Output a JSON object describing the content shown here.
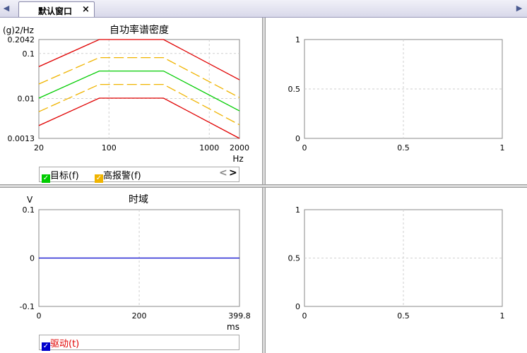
{
  "tabbar": {
    "left_arrow": "◀",
    "right_arrow": "▶",
    "active_tab": "默认窗口",
    "close": "×"
  },
  "psd": {
    "title": "自功率谱密度",
    "ylabel": "(g)2/Hz",
    "xlabel": "Hz",
    "y_ticks": [
      "0.2042",
      "0.1",
      "0.01",
      "0.0013"
    ],
    "x_ticks": [
      "20",
      "100",
      "1000",
      "2000"
    ],
    "legend": {
      "target_label": "目标(f)",
      "target_color": "#00cc00",
      "alarm_label": "高报警(f)",
      "alarm_color": "#f0b400",
      "prev": "<",
      "next": ">"
    }
  },
  "empty_top_right": {
    "y_ticks": [
      "1",
      "0.5",
      "0"
    ],
    "x_ticks": [
      "0",
      "0.5",
      "1"
    ]
  },
  "time": {
    "title": "时域",
    "ylabel": "V",
    "xlabel": "ms",
    "y_ticks": [
      "0.1",
      "0",
      "-0.1"
    ],
    "x_ticks": [
      "0",
      "200",
      "399.8"
    ],
    "legend": {
      "drive_label": "驱动(t)",
      "drive_color": "#0000cc"
    }
  },
  "empty_bottom_right": {
    "y_ticks": [
      "1",
      "0.5",
      "0"
    ],
    "x_ticks": [
      "0",
      "0.5",
      "1"
    ]
  },
  "chart_data": [
    {
      "type": "line",
      "title": "自功率谱密度",
      "xlabel": "Hz",
      "ylabel": "(g)2/Hz",
      "x_scale": "log",
      "y_scale": "log",
      "xlim": [
        20,
        2000
      ],
      "ylim": [
        0.0013,
        0.2042
      ],
      "series": [
        {
          "name": "",
          "color": "#e00000",
          "style": "solid",
          "x": [
            20,
            80,
            350,
            2000
          ],
          "y": [
            0.051,
            0.2042,
            0.2042,
            0.026
          ]
        },
        {
          "name": "高报警(f)",
          "color": "#f0b400",
          "style": "dashed",
          "x": [
            20,
            80,
            350,
            2000
          ],
          "y": [
            0.021,
            0.081,
            0.081,
            0.0105
          ]
        },
        {
          "name": "目标(f)",
          "color": "#00cc00",
          "style": "solid",
          "x": [
            20,
            80,
            350,
            2000
          ],
          "y": [
            0.0102,
            0.0408,
            0.0408,
            0.0053
          ]
        },
        {
          "name": "",
          "color": "#f0b400",
          "style": "dashed",
          "x": [
            20,
            80,
            350,
            2000
          ],
          "y": [
            0.0051,
            0.0205,
            0.0205,
            0.0026
          ]
        },
        {
          "name": "",
          "color": "#e00000",
          "style": "solid",
          "x": [
            20,
            80,
            350,
            2000
          ],
          "y": [
            0.0025,
            0.0102,
            0.0102,
            0.0013
          ]
        }
      ],
      "grid": true
    },
    {
      "type": "line",
      "title": "",
      "xlim": [
        0,
        1
      ],
      "ylim": [
        0,
        1
      ],
      "series": [],
      "grid": true
    },
    {
      "type": "line",
      "title": "时域",
      "xlabel": "ms",
      "ylabel": "V",
      "xlim": [
        0,
        399.8
      ],
      "ylim": [
        -0.1,
        0.1
      ],
      "series": [
        {
          "name": "驱动(t)",
          "color": "#0000cc",
          "x": [
            0,
            399.8
          ],
          "y": [
            0,
            0
          ]
        }
      ],
      "grid": true
    },
    {
      "type": "line",
      "title": "",
      "xlim": [
        0,
        1
      ],
      "ylim": [
        0,
        1
      ],
      "series": [],
      "grid": true
    }
  ]
}
